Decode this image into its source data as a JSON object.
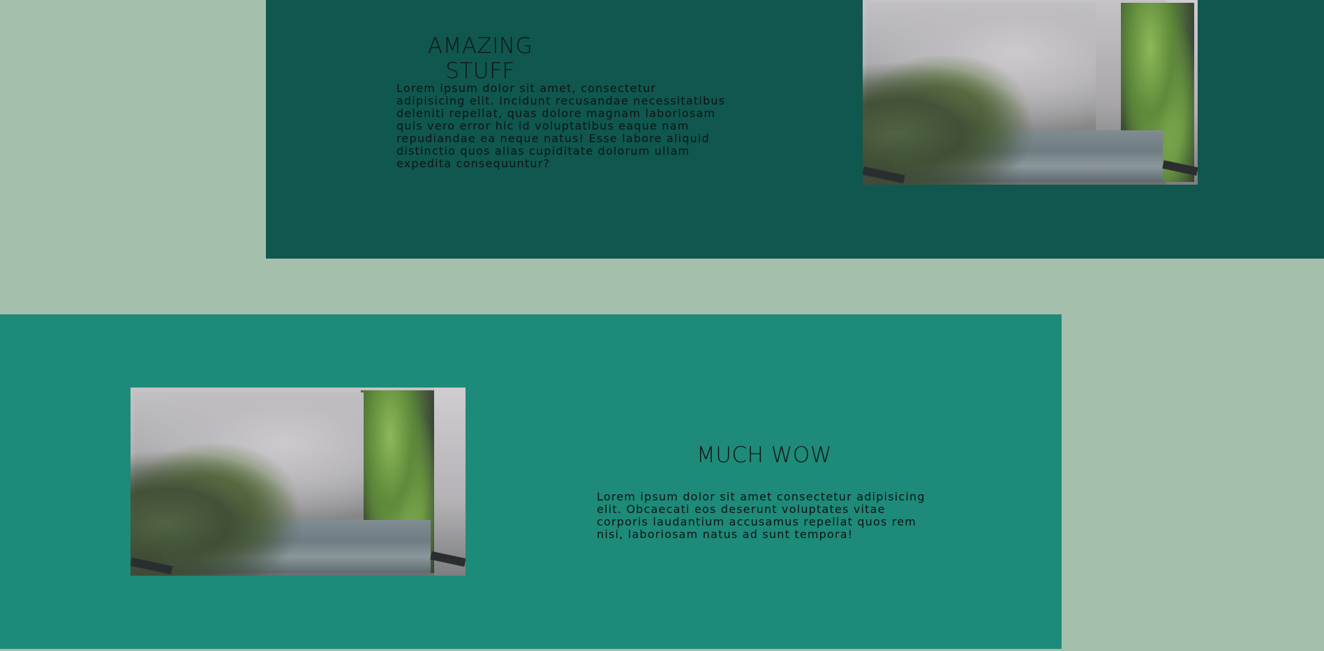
{
  "sections": [
    {
      "title": "AMAZING STUFF",
      "body": "Lorem ipsum dolor sit amet, consectetur adipisicing elit. Incidunt recusandae necessitatibus deleniti repellat, quas dolore magnam laboriosam quis vero error hic id voluptatibus eaque nam repudiandae ea neque natus! Esse labore aliquid distinctio quos alias cupiditate dolorum ullam expedita consequuntur?",
      "image": "misty-forest-waterfall-photo"
    },
    {
      "title": "MUCH WOW",
      "body": "Lorem ipsum dolor sit amet consectetur adipisicing elit. Obcaecati eos deserunt voluptates vitae corporis laudantium accusamus repellat quos rem nisi, laboriosam natus ad sunt tempora!",
      "image": "misty-forest-waterfall-photo"
    }
  ],
  "colors": {
    "page_background": "#a5bfad",
    "section_dark": "#0f574f",
    "section_teal": "#1e8a79"
  }
}
